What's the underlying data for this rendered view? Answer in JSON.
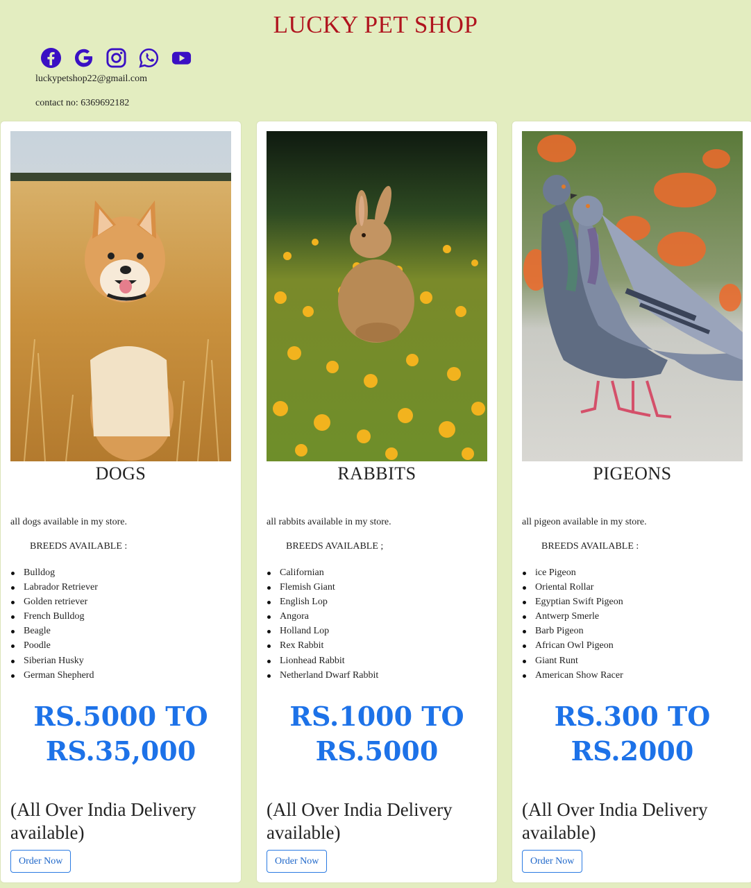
{
  "header": {
    "title": "LUCKY PET SHOP",
    "email": "luckypetshop22@gmail.com",
    "contact": "contact no: 6369692182",
    "social_icons": [
      "facebook-icon",
      "google-icon",
      "instagram-icon",
      "whatsapp-icon",
      "youtube-icon"
    ],
    "icon_color": "#3a10c4",
    "title_color": "#b0141e"
  },
  "theme": {
    "page_bg": "#e3edc0",
    "price_color": "#1d72e8"
  },
  "cards": [
    {
      "title": "DOGS",
      "description": "all dogs available in my store.",
      "breeds_title": "BREEDS AVAILABLE :",
      "breeds": [
        "Bulldog",
        "Labrador Retriever",
        "Golden retriever",
        "French Bulldog",
        "Beagle",
        "Poodle",
        "Siberian Husky",
        "German Shepherd"
      ],
      "price_line1": "RS.5000 TO",
      "price_line2": "RS.35,000",
      "delivery": "(All Over India Delivery available)",
      "button": "Order Now"
    },
    {
      "title": "RABBITS",
      "description": "all rabbits available in my store.",
      "breeds_title": "BREEDS AVAILABLE ;",
      "breeds": [
        "Californian",
        "Flemish Giant",
        "English Lop",
        "Angora",
        "Holland Lop",
        "Rex Rabbit",
        "Lionhead Rabbit",
        "Netherland Dwarf Rabbit"
      ],
      "price_line1": "RS.1000 TO",
      "price_line2": "RS.5000",
      "delivery": "(All Over India Delivery available)",
      "button": "Order Now"
    },
    {
      "title": "PIGEONS",
      "description": "all pigeon available in my store.",
      "breeds_title": "BREEDS AVAILABLE :",
      "breeds": [
        "ice Pigeon",
        "Oriental Rollar",
        "Egyptian Swift Pigeon",
        "Antwerp Smerle",
        "Barb Pigeon",
        "African Owl Pigeon",
        "Giant Runt",
        "American Show Racer"
      ],
      "price_line1": "RS.300 TO",
      "price_line2": "RS.2000",
      "delivery": "(All Over India Delivery available)",
      "button": "Order Now"
    }
  ]
}
